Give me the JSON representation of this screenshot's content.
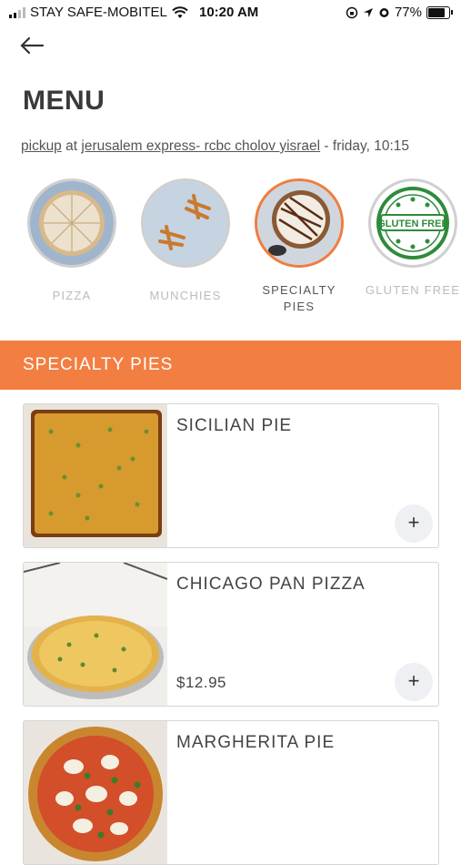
{
  "status": {
    "carrier": "STAY SAFE-MOBITEL",
    "time": "10:20 AM",
    "battery": "77%",
    "battery_level": 0.77
  },
  "header": {
    "back_icon": "back-arrow-icon",
    "title": "MENU"
  },
  "order_info": {
    "mode": "pickup",
    "at": "at",
    "location": "jerusalem express- rcbc cholov yisrael",
    "time": "- friday, 10:15"
  },
  "categories": [
    {
      "label": "PIZZA",
      "active": false
    },
    {
      "label": "MUNCHIES",
      "active": false
    },
    {
      "label": "SPECIALTY PIES",
      "active": true
    },
    {
      "label": "GLUTEN FREE",
      "active": false,
      "badge": "GLUTEN FREE"
    }
  ],
  "section": {
    "title": "SPECIALTY PIES"
  },
  "items": [
    {
      "name": "SICILIAN PIE",
      "price": "",
      "add": "+"
    },
    {
      "name": "CHICAGO PAN PIZZA",
      "price": "$12.95",
      "add": "+"
    },
    {
      "name": "MARGHERITA PIE",
      "price": "",
      "add": "+"
    }
  ],
  "colors": {
    "accent": "#f37e41"
  }
}
